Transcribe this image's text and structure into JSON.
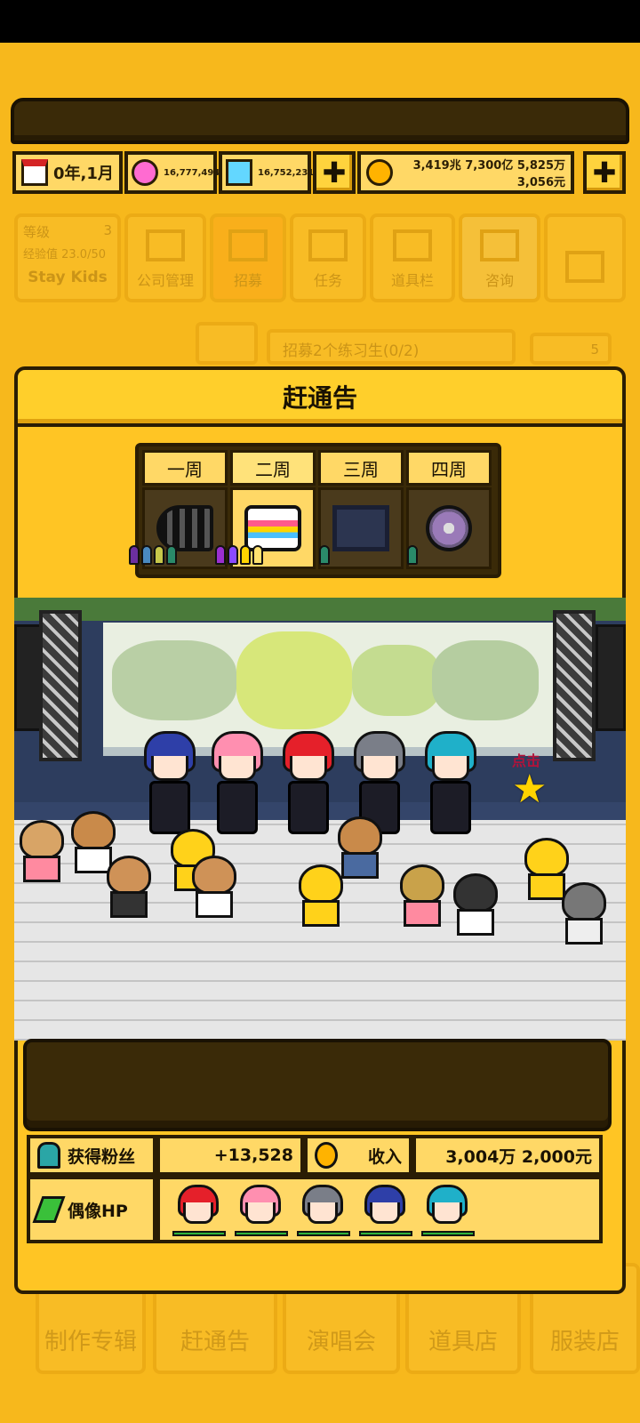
{
  "resources": {
    "date": "0年,1月",
    "pink_gem": "16,777,494",
    "blue_gem": "16,752,231",
    "money_line1": "3,419兆 7,300亿 5,825万",
    "money_line2": "3,056元"
  },
  "background_menu": {
    "level_label": "等级",
    "level_value": "3",
    "exp_label": "经验值 23.0/50",
    "group_name": "Stay Kids",
    "tiles": [
      "公司管理",
      "招募",
      "任务",
      "道具栏",
      "咨询"
    ],
    "mission_text": "招募2个练习生(0/2)",
    "mission_count": "5",
    "bottom_tiles": [
      "制作专辑",
      "赶通告",
      "演唱会",
      "道具店",
      "服装店"
    ]
  },
  "dialog": {
    "title": "赶通告",
    "tabs": [
      {
        "label": "一周",
        "active": false
      },
      {
        "label": "二周",
        "active": true
      },
      {
        "label": "三周",
        "active": false
      },
      {
        "label": "四周",
        "active": false
      }
    ]
  },
  "stage": {
    "tap_hint": "点击",
    "idols": [
      {
        "hair_color": "#2e3fa8"
      },
      {
        "hair_color": "#ff8fb0"
      },
      {
        "hair_color": "#e5202a"
      },
      {
        "hair_color": "#7a7e88"
      },
      {
        "hair_color": "#1fb0c9"
      }
    ]
  },
  "results": {
    "fans_label": "获得粉丝",
    "fans_value": "+13,528",
    "income_label": "收入",
    "income_value": "3,004万 2,000元",
    "hp_label": "偶像HP",
    "hp_members": [
      {
        "hair_color": "#e5202a",
        "hp": 1.0
      },
      {
        "hair_color": "#ff8fb0",
        "hp": 1.0
      },
      {
        "hair_color": "#7a7e88",
        "hp": 1.0
      },
      {
        "hair_color": "#2e3fa8",
        "hp": 1.0
      },
      {
        "hair_color": "#1fb0c9",
        "hp": 1.0
      }
    ]
  },
  "colors": {
    "background": "#f7b81c",
    "panel": "#ffc524",
    "border": "#2a1d04",
    "hp_bar": "#2fb23a"
  }
}
